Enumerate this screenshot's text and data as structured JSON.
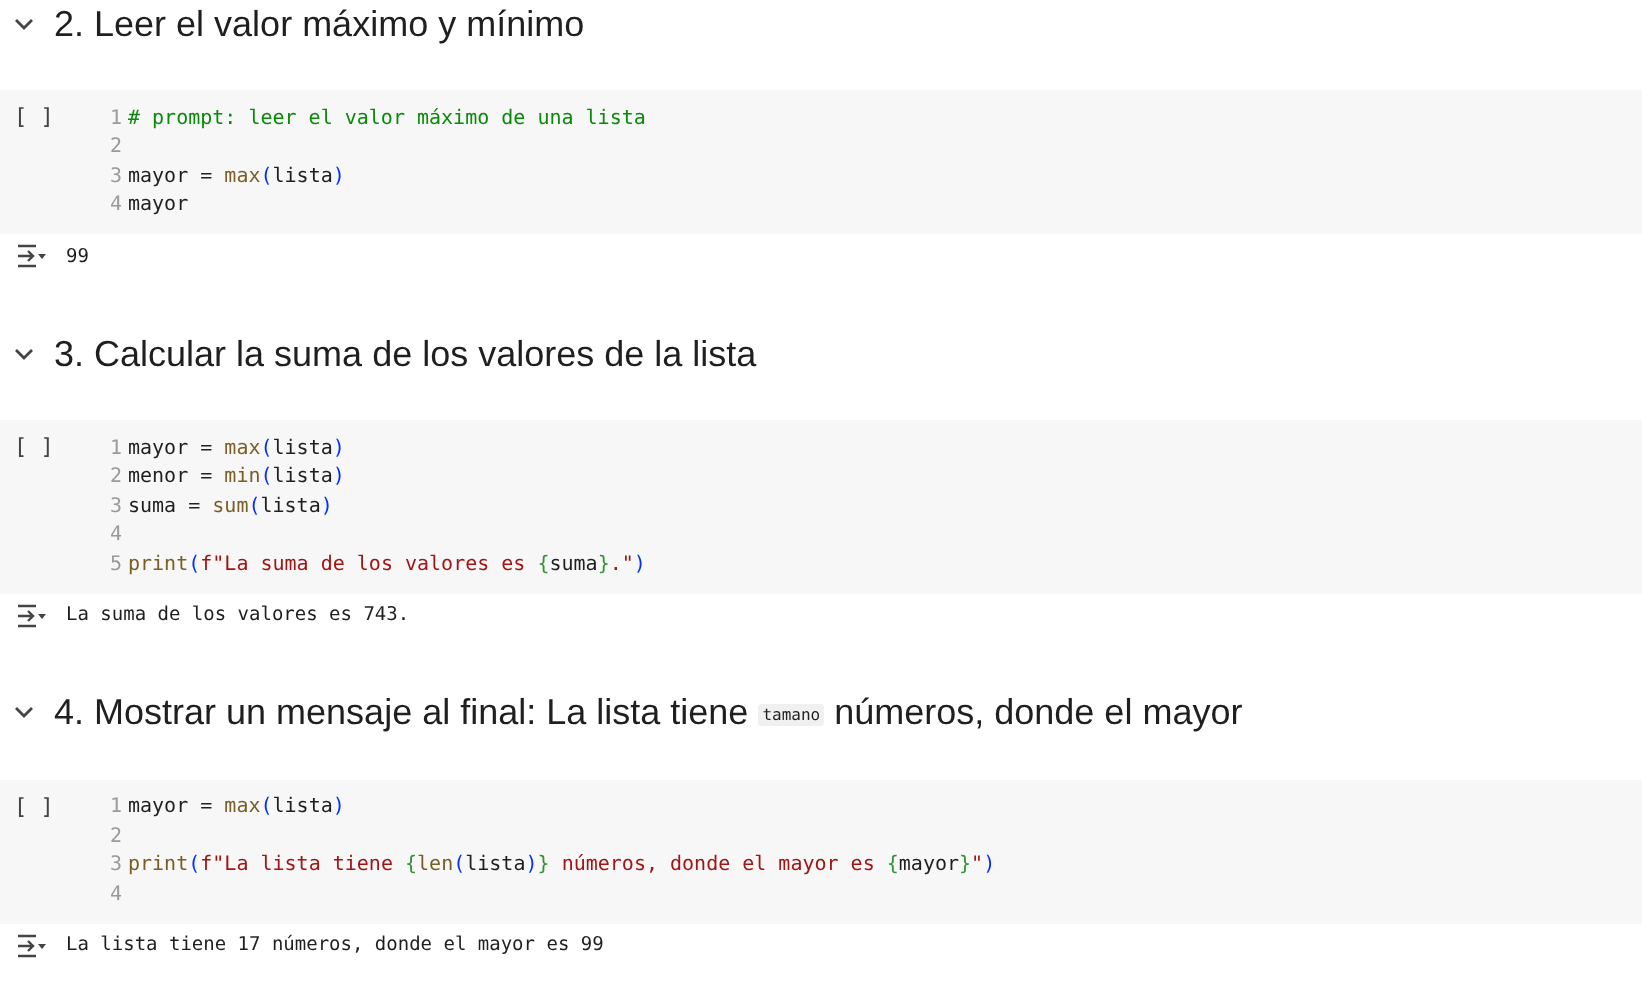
{
  "sections": [
    {
      "heading": [
        {
          "kind": "text",
          "text": "2. Leer el valor máximo y mínimo"
        }
      ],
      "cell": {
        "run_marker": "[ ]",
        "lines": [
          {
            "number": "1",
            "tokens": [
              {
                "kind": "comment",
                "text": "# prompt: leer el valor máximo de una lista"
              }
            ]
          },
          {
            "number": "2"
          },
          {
            "number": "3",
            "tokens": [
              {
                "kind": "plain",
                "text": "mayor = "
              },
              {
                "kind": "builtin",
                "text": "max"
              },
              {
                "kind": "paren",
                "text": "("
              },
              {
                "kind": "plain",
                "text": "lista"
              },
              {
                "kind": "paren",
                "text": ")"
              }
            ]
          },
          {
            "number": "4",
            "tokens": [
              {
                "kind": "plain",
                "text": "mayor"
              }
            ]
          }
        ]
      },
      "output": "99"
    },
    {
      "heading": [
        {
          "kind": "text",
          "text": "3. Calcular la suma de los valores de la lista"
        }
      ],
      "cell": {
        "run_marker": "[ ]",
        "lines": [
          {
            "number": "1",
            "tokens": [
              {
                "kind": "plain",
                "text": "mayor = "
              },
              {
                "kind": "builtin",
                "text": "max"
              },
              {
                "kind": "paren",
                "text": "("
              },
              {
                "kind": "plain",
                "text": "lista"
              },
              {
                "kind": "paren",
                "text": ")"
              }
            ]
          },
          {
            "number": "2",
            "tokens": [
              {
                "kind": "plain",
                "text": "menor = "
              },
              {
                "kind": "builtin",
                "text": "min"
              },
              {
                "kind": "paren",
                "text": "("
              },
              {
                "kind": "plain",
                "text": "lista"
              },
              {
                "kind": "paren",
                "text": ")"
              }
            ]
          },
          {
            "number": "3",
            "tokens": [
              {
                "kind": "plain",
                "text": "suma = "
              },
              {
                "kind": "builtin",
                "text": "sum"
              },
              {
                "kind": "paren",
                "text": "("
              },
              {
                "kind": "plain",
                "text": "lista"
              },
              {
                "kind": "paren",
                "text": ")"
              }
            ]
          },
          {
            "number": "4"
          },
          {
            "number": "5",
            "tokens": [
              {
                "kind": "builtin",
                "text": "print"
              },
              {
                "kind": "paren",
                "text": "("
              },
              {
                "kind": "string",
                "text": "f\"La suma de los valores es "
              },
              {
                "kind": "brace",
                "text": "{"
              },
              {
                "kind": "plain",
                "text": "suma"
              },
              {
                "kind": "brace",
                "text": "}"
              },
              {
                "kind": "string",
                "text": ".\""
              },
              {
                "kind": "paren",
                "text": ")"
              }
            ]
          }
        ]
      },
      "output": "La suma de los valores es 743."
    },
    {
      "heading": [
        {
          "kind": "text",
          "text": "4. Mostrar un mensaje al final: La lista tiene "
        },
        {
          "kind": "code",
          "text": "tamano"
        },
        {
          "kind": "text",
          "text": " números, donde el mayor"
        }
      ],
      "cell": {
        "run_marker": "[ ]",
        "lines": [
          {
            "number": "1",
            "tokens": [
              {
                "kind": "plain",
                "text": "mayor = "
              },
              {
                "kind": "builtin",
                "text": "max"
              },
              {
                "kind": "paren",
                "text": "("
              },
              {
                "kind": "plain",
                "text": "lista"
              },
              {
                "kind": "paren",
                "text": ")"
              }
            ]
          },
          {
            "number": "2"
          },
          {
            "number": "3",
            "tokens": [
              {
                "kind": "builtin",
                "text": "print"
              },
              {
                "kind": "paren",
                "text": "("
              },
              {
                "kind": "string",
                "text": "f\"La lista tiene "
              },
              {
                "kind": "brace",
                "text": "{"
              },
              {
                "kind": "builtin",
                "text": "len"
              },
              {
                "kind": "paren",
                "text": "("
              },
              {
                "kind": "plain",
                "text": "lista"
              },
              {
                "kind": "paren",
                "text": ")"
              },
              {
                "kind": "brace",
                "text": "}"
              },
              {
                "kind": "string",
                "text": " números, donde el mayor es "
              },
              {
                "kind": "brace",
                "text": "{"
              },
              {
                "kind": "plain",
                "text": "mayor"
              },
              {
                "kind": "brace",
                "text": "}"
              },
              {
                "kind": "string",
                "text": "\""
              },
              {
                "kind": "paren",
                "text": ")"
              }
            ]
          },
          {
            "number": "4"
          }
        ]
      },
      "output": "La lista tiene 17 números, donde el mayor es 99"
    }
  ]
}
